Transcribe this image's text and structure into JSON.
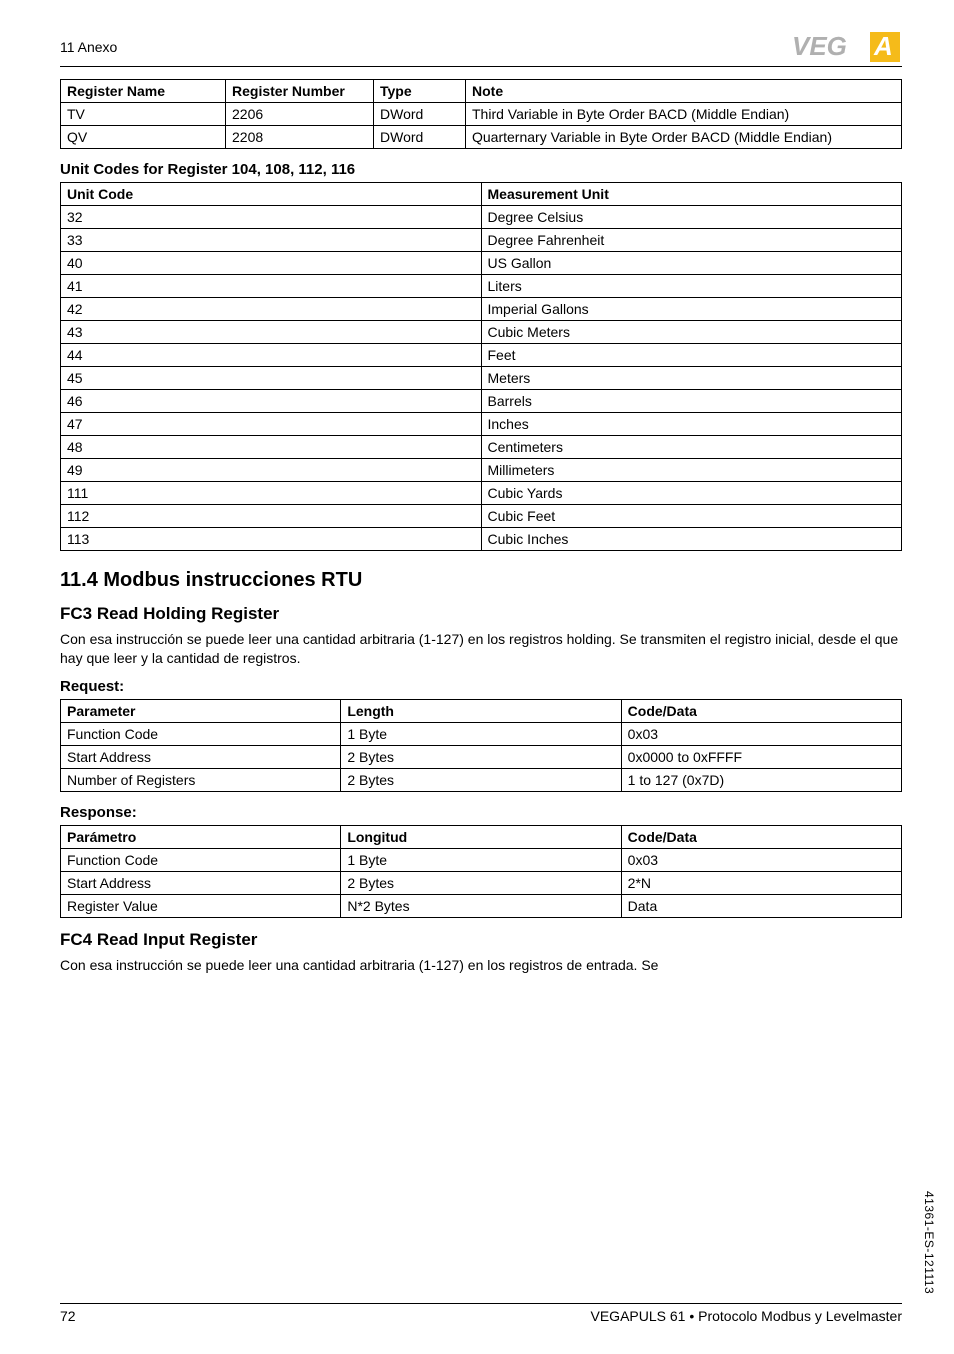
{
  "header": {
    "anexo": "11 Anexo"
  },
  "logo": {
    "text": "VEGA"
  },
  "registers": {
    "headers": [
      "Register Name",
      "Register Number",
      "Type",
      "Note"
    ],
    "rows": [
      [
        "TV",
        "2206",
        "DWord",
        "Third Variable in Byte Order BACD (Middle Endian)"
      ],
      [
        "QV",
        "2208",
        "DWord",
        "Quarternary Variable in Byte Order BACD (Middle Endian)"
      ]
    ]
  },
  "unit_codes_title": "Unit Codes for Register 104, 108, 112, 116",
  "units": {
    "headers": [
      "Unit Code",
      "Measurement Unit"
    ],
    "rows": [
      [
        "32",
        "Degree Celsius"
      ],
      [
        "33",
        "Degree Fahrenheit"
      ],
      [
        "40",
        "US Gallon"
      ],
      [
        "41",
        "Liters"
      ],
      [
        "42",
        "Imperial Gallons"
      ],
      [
        "43",
        "Cubic Meters"
      ],
      [
        "44",
        "Feet"
      ],
      [
        "45",
        "Meters"
      ],
      [
        "46",
        "Barrels"
      ],
      [
        "47",
        "Inches"
      ],
      [
        "48",
        "Centimeters"
      ],
      [
        "49",
        "Millimeters"
      ],
      [
        "111",
        "Cubic Yards"
      ],
      [
        "112",
        "Cubic Feet"
      ],
      [
        "113",
        "Cubic Inches"
      ]
    ]
  },
  "section_114": "11.4   Modbus instrucciones RTU",
  "fc3": {
    "title": "FC3 Read Holding Register",
    "body": "Con esa instrucción se puede leer una cantidad arbitraria (1-127) en los registros holding. Se transmiten el registro inicial, desde el que hay que leer  y la cantidad de registros.",
    "request_label": "Request:",
    "request": {
      "headers": [
        "Parameter",
        "Length",
        "Code/Data"
      ],
      "rows": [
        [
          "Function Code",
          "1 Byte",
          "0x03"
        ],
        [
          "Start Address",
          "2 Bytes",
          "0x0000 to 0xFFFF"
        ],
        [
          "Number of Registers",
          "2 Bytes",
          "1 to 127 (0x7D)"
        ]
      ]
    },
    "response_label": "Response:",
    "response": {
      "headers": [
        "Parámetro",
        "Longitud",
        "Code/Data"
      ],
      "rows": [
        [
          "Function Code",
          "1 Byte",
          "0x03"
        ],
        [
          "Start Address",
          "2 Bytes",
          "2*N"
        ],
        [
          " Register Value",
          "N*2 Bytes",
          "Data"
        ]
      ]
    }
  },
  "fc4": {
    "title": "FC4 Read Input Register",
    "body": "Con esa instrucción se puede leer una cantidad arbitraria (1-127) en los registros de entrada. Se"
  },
  "footer": {
    "page": "72",
    "product": "VEGAPULS 61 • Protocolo Modbus y Levelmaster"
  },
  "side_code": "41361-ES-121113"
}
